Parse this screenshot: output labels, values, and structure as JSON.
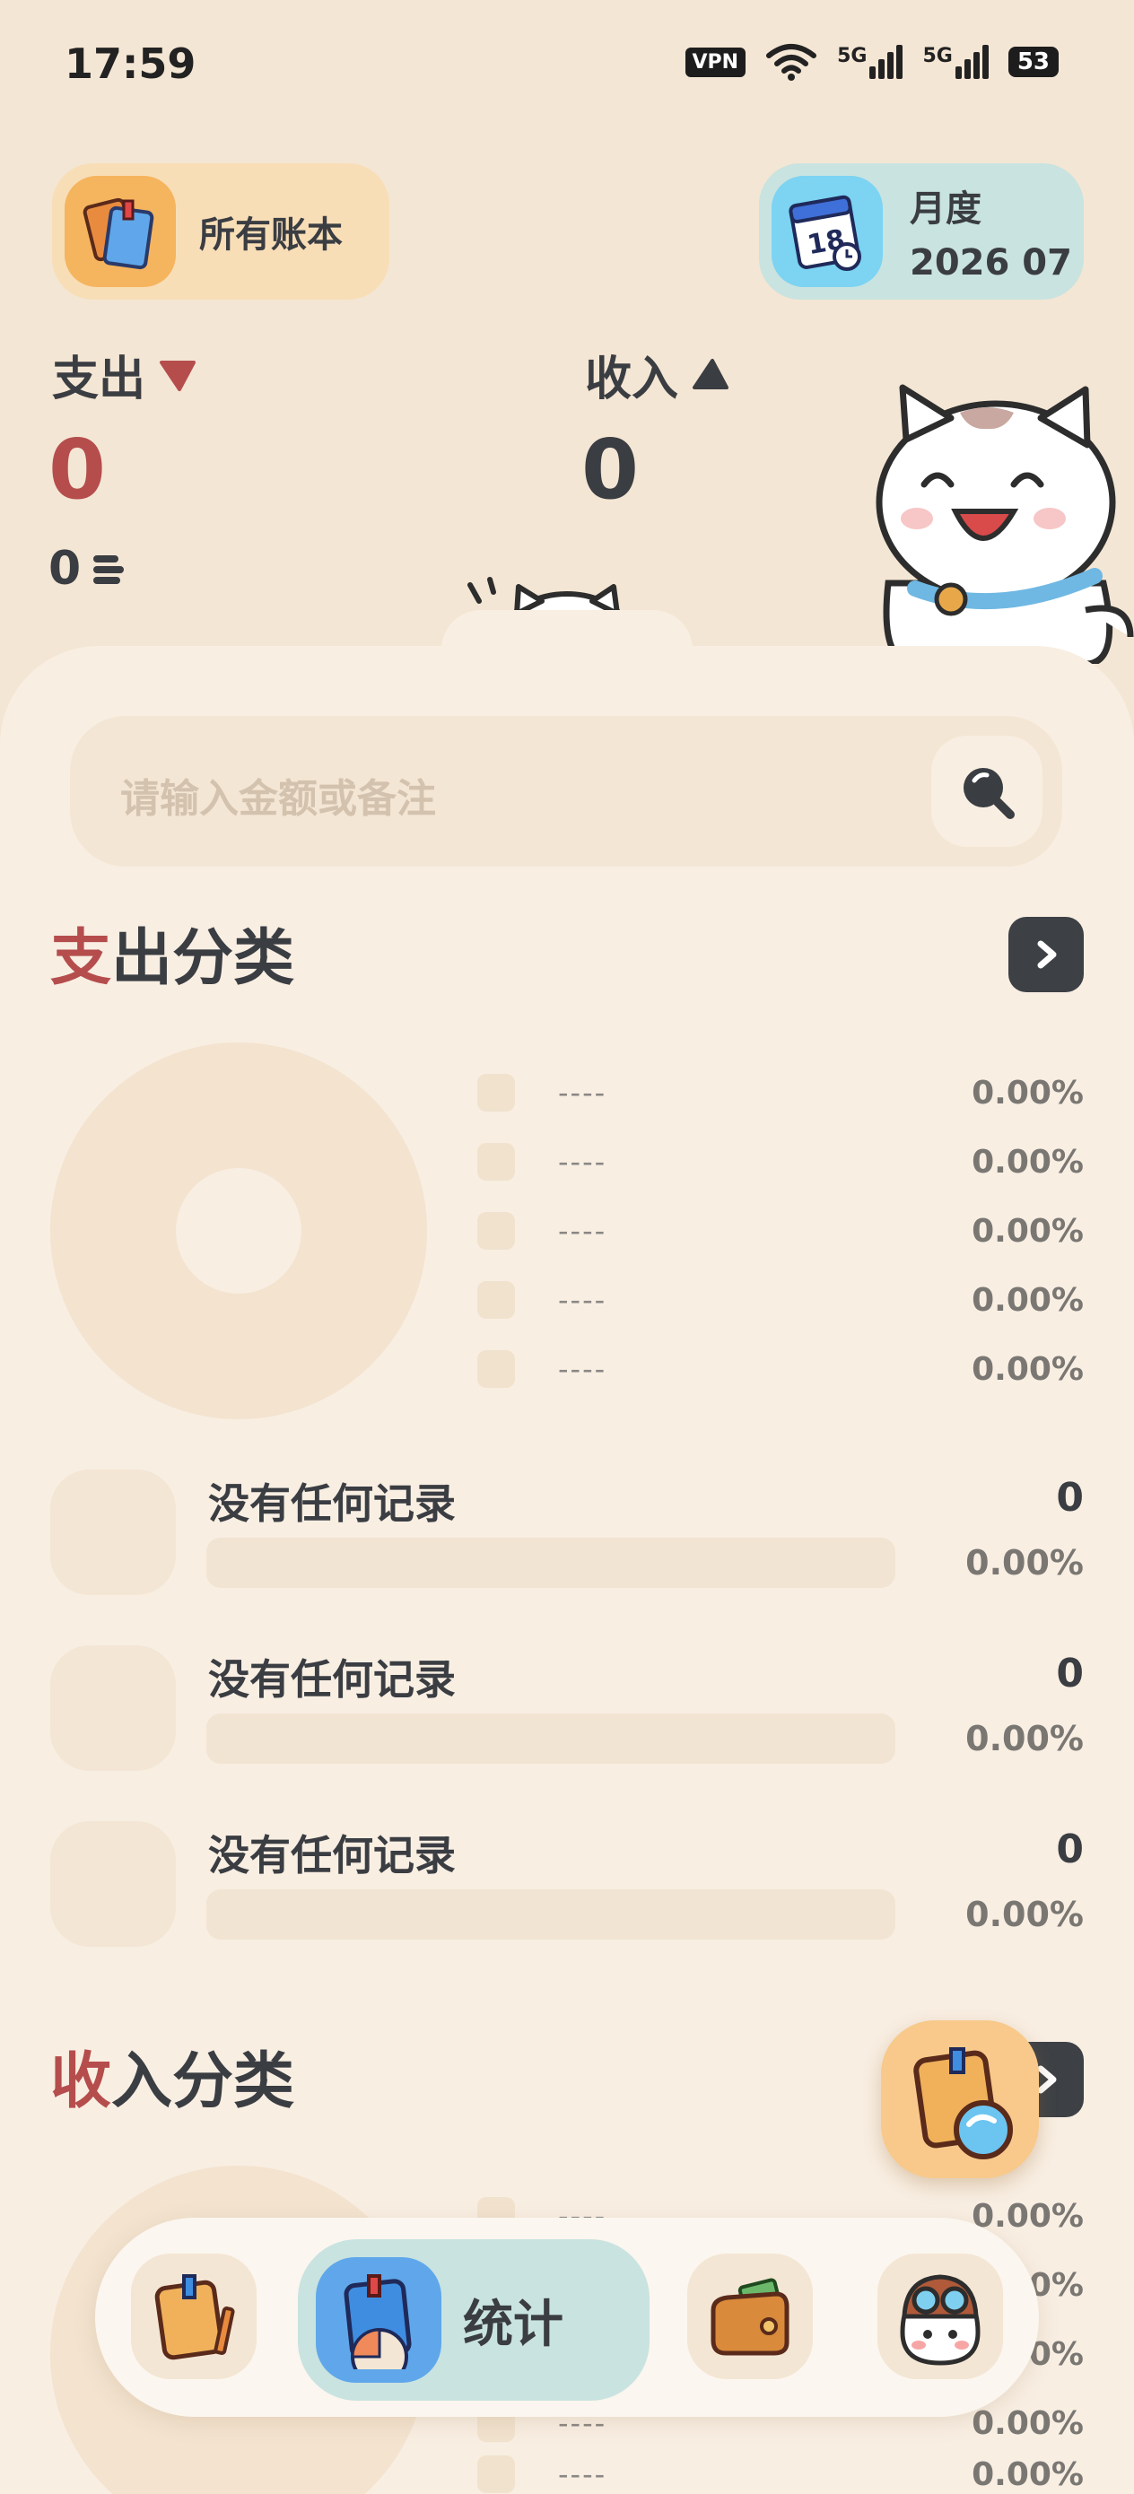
{
  "status_bar": {
    "time": "17:59",
    "vpn": "VPN",
    "signal_1": "5G",
    "signal_2": "5G",
    "battery": "53"
  },
  "header": {
    "books_label": "所有账本",
    "period_type": "月度",
    "period_value": "2026 07"
  },
  "summary": {
    "expense_label": "支出",
    "expense_value": "0",
    "expense_sub_value": "0",
    "income_label": "收入",
    "income_value": "0"
  },
  "search": {
    "placeholder": "请输入金额或备注"
  },
  "expense_section": {
    "title_highlight": "支",
    "title_rest": "出分类",
    "legend": [
      {
        "label": "----",
        "percent": "0.00%"
      },
      {
        "label": "----",
        "percent": "0.00%"
      },
      {
        "label": "----",
        "percent": "0.00%"
      },
      {
        "label": "----",
        "percent": "0.00%"
      },
      {
        "label": "----",
        "percent": "0.00%"
      }
    ],
    "records": [
      {
        "name": "没有任何记录",
        "amount": "0",
        "percent": "0.00%"
      },
      {
        "name": "没有任何记录",
        "amount": "0",
        "percent": "0.00%"
      },
      {
        "name": "没有任何记录",
        "amount": "0",
        "percent": "0.00%"
      }
    ]
  },
  "income_section": {
    "title_highlight": "收",
    "title_rest": "入分类",
    "legend": [
      {
        "label": "----",
        "percent": "0.00%"
      },
      {
        "label": "----",
        "percent": "0.00%"
      },
      {
        "label": "----",
        "percent": "0.00%"
      },
      {
        "label": "----",
        "percent": "0.00%"
      },
      {
        "label": "----",
        "percent": "0.00%"
      }
    ]
  },
  "bottom_nav": {
    "active_label": "统计",
    "items": [
      "ledger-book-icon",
      "statistics-icon",
      "wallet-icon",
      "cat-pilot-icon"
    ]
  },
  "colors": {
    "background": "#F4E6D4",
    "sheet": "#F8EEE2",
    "expense_red": "#B54D4D",
    "text_dark": "#3A3D42",
    "accent_teal": "#C9E3E0",
    "accent_orange": "#F8DEB7"
  }
}
